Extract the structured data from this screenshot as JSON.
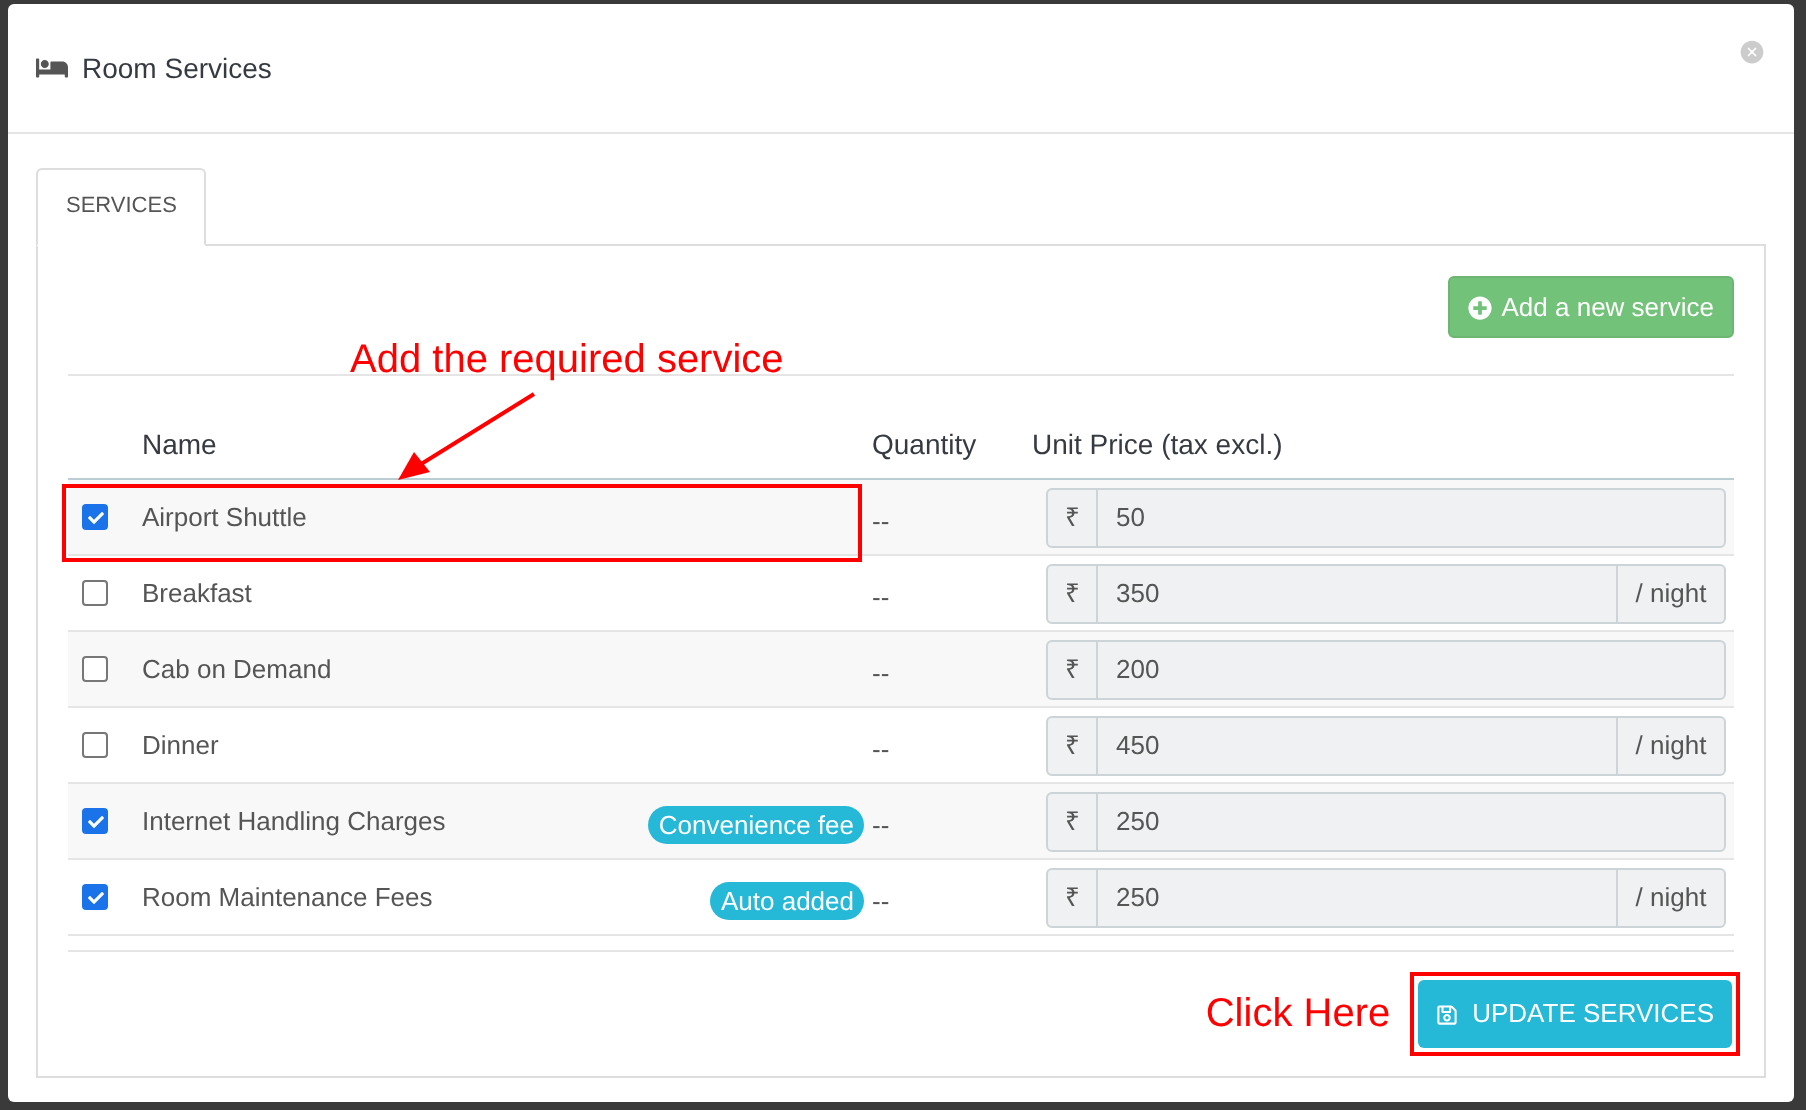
{
  "window": {
    "title": "Room Services"
  },
  "tabs": [
    {
      "label": "SERVICES",
      "selected": true
    }
  ],
  "add_button": "Add a new service",
  "columns": [
    "Name",
    "Quantity",
    "Unit Price (tax excl.)"
  ],
  "rows": [
    {
      "checked": true,
      "name": "Airport Shuttle",
      "quantity": "--",
      "currency": "₹",
      "price": "50"
    },
    {
      "checked": false,
      "name": "Breakfast",
      "quantity": "--",
      "currency": "₹",
      "price": "350",
      "unit": "/ night"
    },
    {
      "checked": false,
      "name": "Cab on Demand",
      "quantity": "--",
      "currency": "₹",
      "price": "200"
    },
    {
      "checked": false,
      "name": "Dinner",
      "quantity": "--",
      "currency": "₹",
      "price": "450",
      "unit": "/ night"
    },
    {
      "checked": true,
      "name": "Internet Handling Charges",
      "badge": "Convenience fee",
      "quantity": "--",
      "currency": "₹",
      "price": "250"
    },
    {
      "checked": true,
      "name": "Room Maintenance Fees",
      "badge": "Auto added",
      "quantity": "--",
      "currency": "₹",
      "price": "250",
      "unit": "/ night"
    }
  ],
  "annotations": {
    "row_hint": "Add the required service",
    "button_hint": "Click Here"
  },
  "update_button": "UPDATE SERVICES"
}
